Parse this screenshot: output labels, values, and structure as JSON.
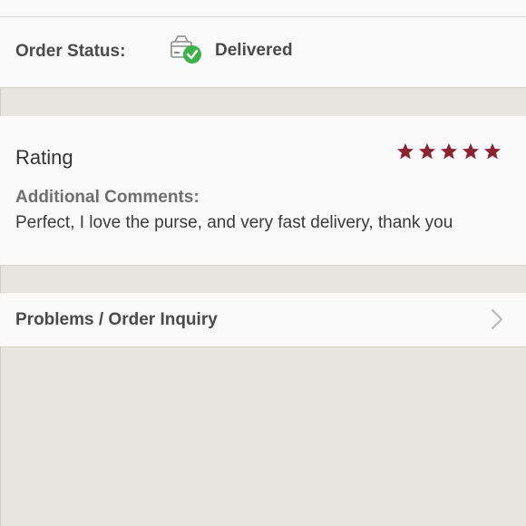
{
  "order_status": {
    "label": "Order Status:",
    "value": "Delivered",
    "icon": "package-delivered-icon"
  },
  "rating": {
    "title": "Rating",
    "stars": 5,
    "max_stars": 5,
    "star_color": "#8c2232",
    "comments_label": "Additional Comments:",
    "comments_text": "Perfect, I love the purse, and very fast delivery, thank you"
  },
  "inquiry": {
    "label": "Problems / Order Inquiry",
    "icon": "chevron-right-icon"
  },
  "colors": {
    "background": "#e7e4df",
    "card": "#fbfafa",
    "success_green": "#3cb34a"
  }
}
